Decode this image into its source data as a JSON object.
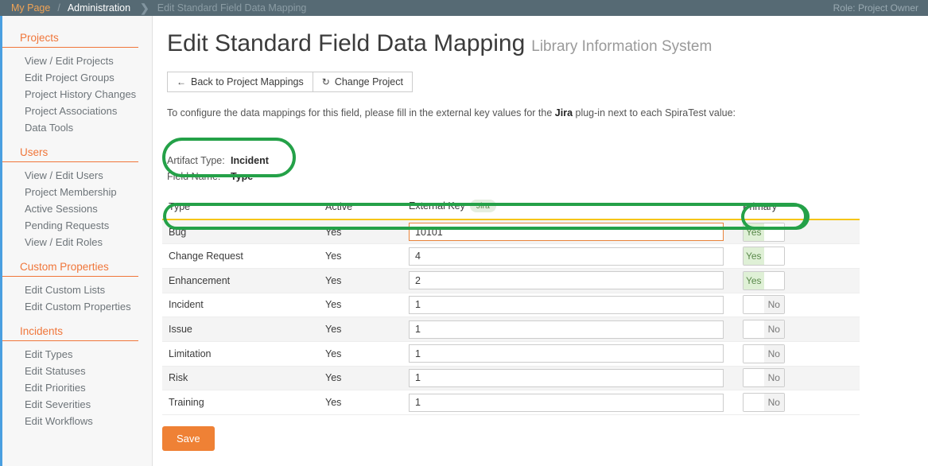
{
  "topbar": {
    "my_page": "My Page",
    "separator": "/",
    "administration": "Administration",
    "chevron": "❯",
    "breadcrumb": "Edit Standard Field Data Mapping",
    "role": "Role: Project Owner"
  },
  "sidebar": {
    "groups": [
      {
        "heading": "Projects",
        "items": [
          "View / Edit Projects",
          "Edit Project Groups",
          "Project History Changes",
          "Project Associations",
          "Data Tools"
        ]
      },
      {
        "heading": "Users",
        "items": [
          "View / Edit Users",
          "Project Membership",
          "Active Sessions",
          "Pending Requests",
          "View / Edit Roles"
        ]
      },
      {
        "heading": "Custom Properties",
        "items": [
          "Edit Custom Lists",
          "Edit Custom Properties"
        ]
      },
      {
        "heading": "Incidents",
        "items": [
          "Edit Types",
          "Edit Statuses",
          "Edit Priorities",
          "Edit Severities",
          "Edit Workflows"
        ]
      }
    ]
  },
  "main": {
    "title": "Edit Standard Field Data Mapping",
    "project_name": "Library Information System",
    "buttons": {
      "back_label": "Back to Project Mappings",
      "back_icon": "←",
      "change_label": "Change Project",
      "change_icon": "↻"
    },
    "intro": {
      "part1": "To configure the data mappings for this field, please fill in the external key values for the ",
      "plugin": "Jira",
      "part2": " plug-in next to each SpiraTest value:"
    },
    "info": {
      "artifact_type_label": "Artifact Type:",
      "artifact_type_value": "Incident",
      "field_name_label": "Field Name:",
      "field_name_value": "Type"
    },
    "table": {
      "headers": {
        "type": "Type",
        "active": "Active",
        "external_key": "External Key",
        "external_key_badge": "Jira",
        "primary": "Primary"
      },
      "rows": [
        {
          "type": "Bug",
          "active": "Yes",
          "external_key": "10101",
          "primary": "Yes",
          "primary_on": true,
          "focused": true
        },
        {
          "type": "Change Request",
          "active": "Yes",
          "external_key": "4",
          "primary": "Yes",
          "primary_on": true,
          "focused": false
        },
        {
          "type": "Enhancement",
          "active": "Yes",
          "external_key": "2",
          "primary": "Yes",
          "primary_on": true,
          "focused": false
        },
        {
          "type": "Incident",
          "active": "Yes",
          "external_key": "1",
          "primary": "No",
          "primary_on": false,
          "focused": false
        },
        {
          "type": "Issue",
          "active": "Yes",
          "external_key": "1",
          "primary": "No",
          "primary_on": false,
          "focused": false
        },
        {
          "type": "Limitation",
          "active": "Yes",
          "external_key": "1",
          "primary": "No",
          "primary_on": false,
          "focused": false
        },
        {
          "type": "Risk",
          "active": "Yes",
          "external_key": "1",
          "primary": "No",
          "primary_on": false,
          "focused": false
        },
        {
          "type": "Training",
          "active": "Yes",
          "external_key": "1",
          "primary": "No",
          "primary_on": false,
          "focused": false
        }
      ]
    },
    "save_label": "Save"
  },
  "colors": {
    "topbar_bg": "#566a74",
    "accent_orange": "#f0763a",
    "link_orange": "#f0a355",
    "save_orange": "#ef8135",
    "annotation_green": "#24a148",
    "header_underline": "#f5c518",
    "left_rail_blue": "#4a9fe0"
  }
}
